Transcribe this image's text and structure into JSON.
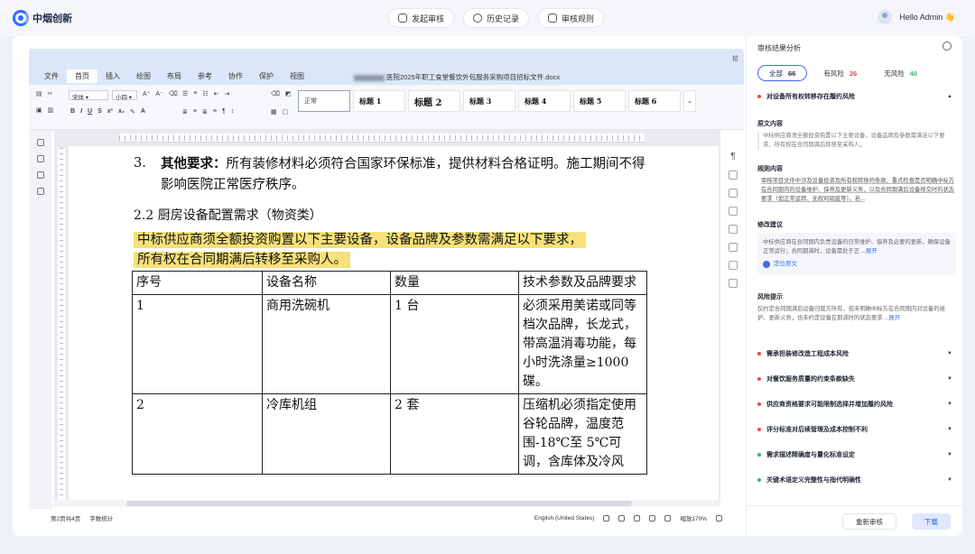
{
  "app": {
    "logo_text": "中烟创新"
  },
  "topnav": {
    "start_review": "发起审核",
    "history": "历史记录",
    "rules": "审核规则"
  },
  "user": {
    "greeting": "Hello Admin 👋"
  },
  "editor": {
    "menu_tabs": [
      "文件",
      "首页",
      "插入",
      "绘图",
      "布局",
      "参考",
      "协作",
      "保护",
      "视图"
    ],
    "doc_title": "医院2025年职工食堂餐饮外包服务采购项目招标文件.docx",
    "corner": "拾",
    "font_name": "宋体",
    "font_size": "小四",
    "styles": [
      "正常",
      "标题 1",
      "标题 2",
      "标题 3",
      "标题 4",
      "标题 5",
      "标题 6"
    ],
    "ruler_numbers": "1 · 2 · 4 · 6 · 8 · 10 · 12 · 14 · 16 · 18 · 20 · 22 · 24 · 26 · 28 · 30 · 32 · 34 · 36 · 38 · 40 · 42 · 44 · 46 · 48 · 50 · 52 · 54 · 56 · 58 · 60 · 62 · 64 · 66 · 68 · 70 · 72 · 74 · 76 · 78 · 80 · 82",
    "page": {
      "item3_num": "3.",
      "item3_bold": "其他要求：",
      "item3_text": "所有装修材料必须符合国家环保标准，提供材料合格证明。施工期间不得影响医院正常医疗秩序。",
      "section_heading": "2.2 厨房设备配置需求（物资类）",
      "highlight_line1": "中标供应商须全额投资购置以下主要设备，设备品牌及参数需满足以下要求，",
      "highlight_line2": "所有权在合同期满后转移至采购人。",
      "table_headers": [
        "序号",
        "设备名称",
        "数量",
        "技术参数及品牌要求"
      ],
      "table_rows": [
        [
          "1",
          "商用洗碗机",
          "1 台",
          "必须采用美诺或同等档次品牌，长龙式，带高温消毒功能，每小时洗涤量≥1000 碟。"
        ],
        [
          "2",
          "冷库机组",
          "2 套",
          "压缩机必须指定使用谷轮品牌，温度范围-18℃至 5℃可调，含库体及冷风"
        ]
      ]
    },
    "status": {
      "page_info": "第2页共4页",
      "word_count": "字数统计",
      "language": "English (United States)",
      "zoom": "缩放170%"
    }
  },
  "panel": {
    "title": "审核结果分析",
    "filters": [
      {
        "label": "全部",
        "count": "66"
      },
      {
        "label": "有风险",
        "count": "26"
      },
      {
        "label": "无风险",
        "count": "40"
      }
    ],
    "open_risk": {
      "title": "对设备所有权转移存在履约风险",
      "original_h": "原文内容",
      "original_b": "中标供应商须全额投资购置以下主要设备，设备品牌及参数需满足以下要求，所有权在合同期满后转移至采购人。",
      "rule_h": "规则内容",
      "rule_b": "审核项目文件中涉及设备投资及所有权转移的条款，重点检查是否明确中标方在合同期内的设备维护、保养及更新义务，以及合同期满后设备移交时的状态要求（如正常运转、无权利瑕疵等）。若...",
      "suggest_h": "修改建议",
      "suggest_b": "中标供应商在合同期内负责设备的日常维护、保养及必要的更新，确保设备正常运行；合同期满时，设备需处于正",
      "expand": "...展开",
      "jump": "定位原文",
      "tip_h": "风险提示",
      "tip_b": "仅约定合同期满后设备归我方所有，但未明确中标方在合同期内对设备的维护、更新义务，也未约定设备在期满时的状态要求"
    },
    "risks": [
      {
        "title": "需承担装修改造工程成本风险",
        "level": "red"
      },
      {
        "title": "对餐饮服务质量的约束条款缺失",
        "level": "red"
      },
      {
        "title": "供应商资格要求可能限制选择并增加履约风险",
        "level": "red"
      },
      {
        "title": "评分标准对后续管理及成本控制不利",
        "level": "red"
      },
      {
        "title": "需求描述精确度与量化标准设定",
        "level": "green"
      },
      {
        "title": "关键术语定义完整性与指代明确性",
        "level": "green"
      }
    ],
    "buttons": {
      "re_review": "重新审核",
      "download": "下载"
    }
  },
  "colors": {
    "accent": "#3d6bf2",
    "risk_red": "#e24c4c",
    "safe_green": "#3bb273",
    "highlight": "#f6e27a"
  }
}
